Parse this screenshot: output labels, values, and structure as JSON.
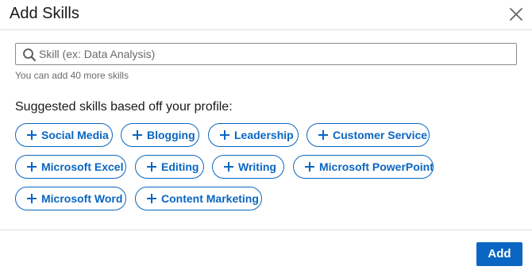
{
  "modal": {
    "title": "Add Skills",
    "close_icon": "close-icon"
  },
  "search": {
    "placeholder": "Skill (ex: Data Analysis)",
    "value": "",
    "icon": "search-icon"
  },
  "helper_text": "You can add 40 more skills",
  "suggested": {
    "heading": "Suggested skills based off your profile:",
    "skills": [
      "Social Media",
      "Blogging",
      "Leadership",
      "Customer Service",
      "Microsoft Excel",
      "Editing",
      "Writing",
      "Microsoft PowerPoint",
      "Microsoft Word",
      "Content Marketing"
    ]
  },
  "footer": {
    "add_label": "Add"
  },
  "colors": {
    "accent": "#0a66c2",
    "divider": "#e0e0e0"
  }
}
